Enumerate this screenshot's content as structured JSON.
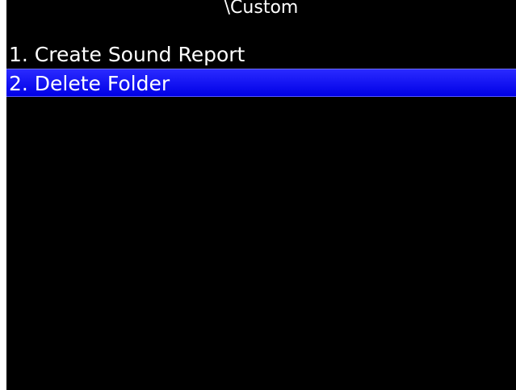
{
  "screen": {
    "title": "\\Custom"
  },
  "menu": {
    "items": [
      {
        "label": "1. Create Sound Report"
      },
      {
        "label": "2. Delete Folder",
        "selected": true
      }
    ]
  },
  "colors": {
    "background": "#000000",
    "text": "#ffffff",
    "selection": "#0a0af0"
  }
}
